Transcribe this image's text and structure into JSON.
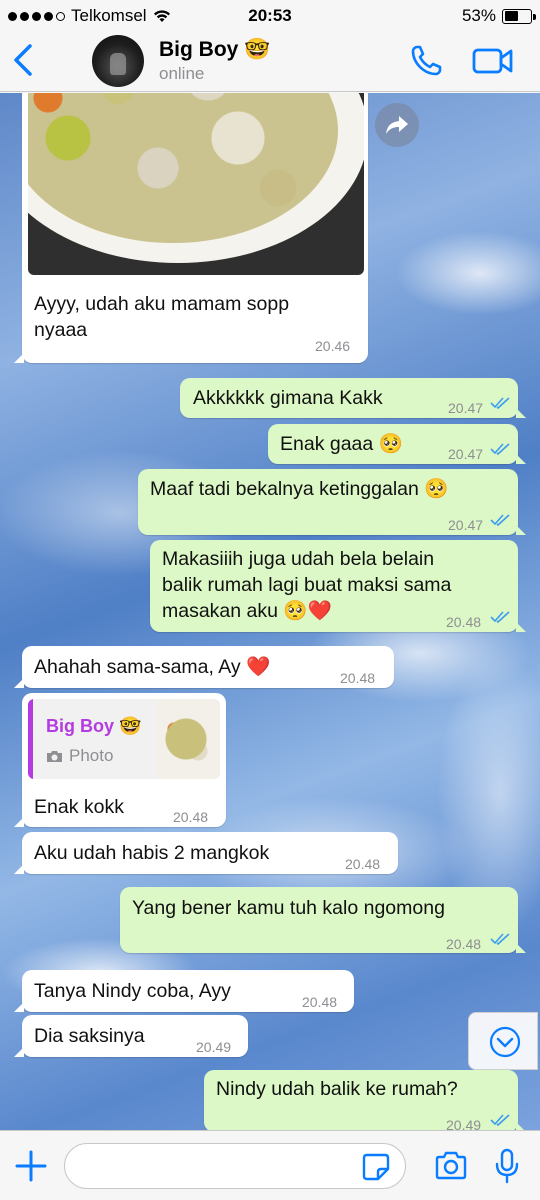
{
  "status_bar": {
    "carrier": "Telkomsel",
    "time": "20:53",
    "battery": "53%",
    "battery_level": 0.53
  },
  "header": {
    "contact_name": "Big Boy",
    "contact_status": "online",
    "emoji": "🤓"
  },
  "messages": [
    {
      "direction": "in",
      "text_lines": [
        "Ayyy, udah aku mamam sopp",
        "nyaaa"
      ],
      "time": "20.46",
      "has_image": true
    },
    {
      "direction": "out",
      "text": "Akkkkkk gimana Kakk",
      "time": "20.47"
    },
    {
      "direction": "out",
      "text": "Enak gaaa 🥺",
      "time": "20.47"
    },
    {
      "direction": "out",
      "text": "Maaf tadi bekalnya ketinggalan 🥺",
      "time": "20.47"
    },
    {
      "direction": "out",
      "text_lines": [
        "Makasiiih juga udah bela belain",
        "balik rumah lagi buat maksi sama",
        "masakan aku 🥺❤️"
      ],
      "time": "20.48"
    },
    {
      "direction": "in",
      "text": "Ahahah sama-sama, Ay ❤️",
      "time": "20.48"
    },
    {
      "direction": "in",
      "text": "Enak kokk",
      "time": "20.48",
      "quote": {
        "name": "Big Boy",
        "emoji": "🤓",
        "type": "Photo"
      }
    },
    {
      "direction": "in",
      "text": "Aku udah habis 2 mangkok",
      "time": "20.48"
    },
    {
      "direction": "out",
      "text": "Yang bener kamu tuh kalo ngomong",
      "time": "20.48"
    },
    {
      "direction": "in",
      "text": "Tanya Nindy coba, Ayy",
      "time": "20.48"
    },
    {
      "direction": "in",
      "text": "Dia saksinya",
      "time": "20.49"
    },
    {
      "direction": "out",
      "text": "Nindy udah balik ke rumah?",
      "time": "20.49"
    }
  ],
  "input": {
    "placeholder": "",
    "value": ""
  },
  "colors": {
    "accent": "#0a7cff",
    "outgoing_bubble": "#dcf8c6",
    "incoming_bubble": "#ffffff",
    "read_ticks": "#3b9cf0",
    "quote_name": "#b43be0"
  },
  "icons": [
    "back-icon",
    "phone-icon",
    "video-icon",
    "forward-icon",
    "camera-icon",
    "chevron-down-icon",
    "plus-icon",
    "sticker-icon",
    "microphone-icon",
    "wifi-icon",
    "battery-icon"
  ]
}
